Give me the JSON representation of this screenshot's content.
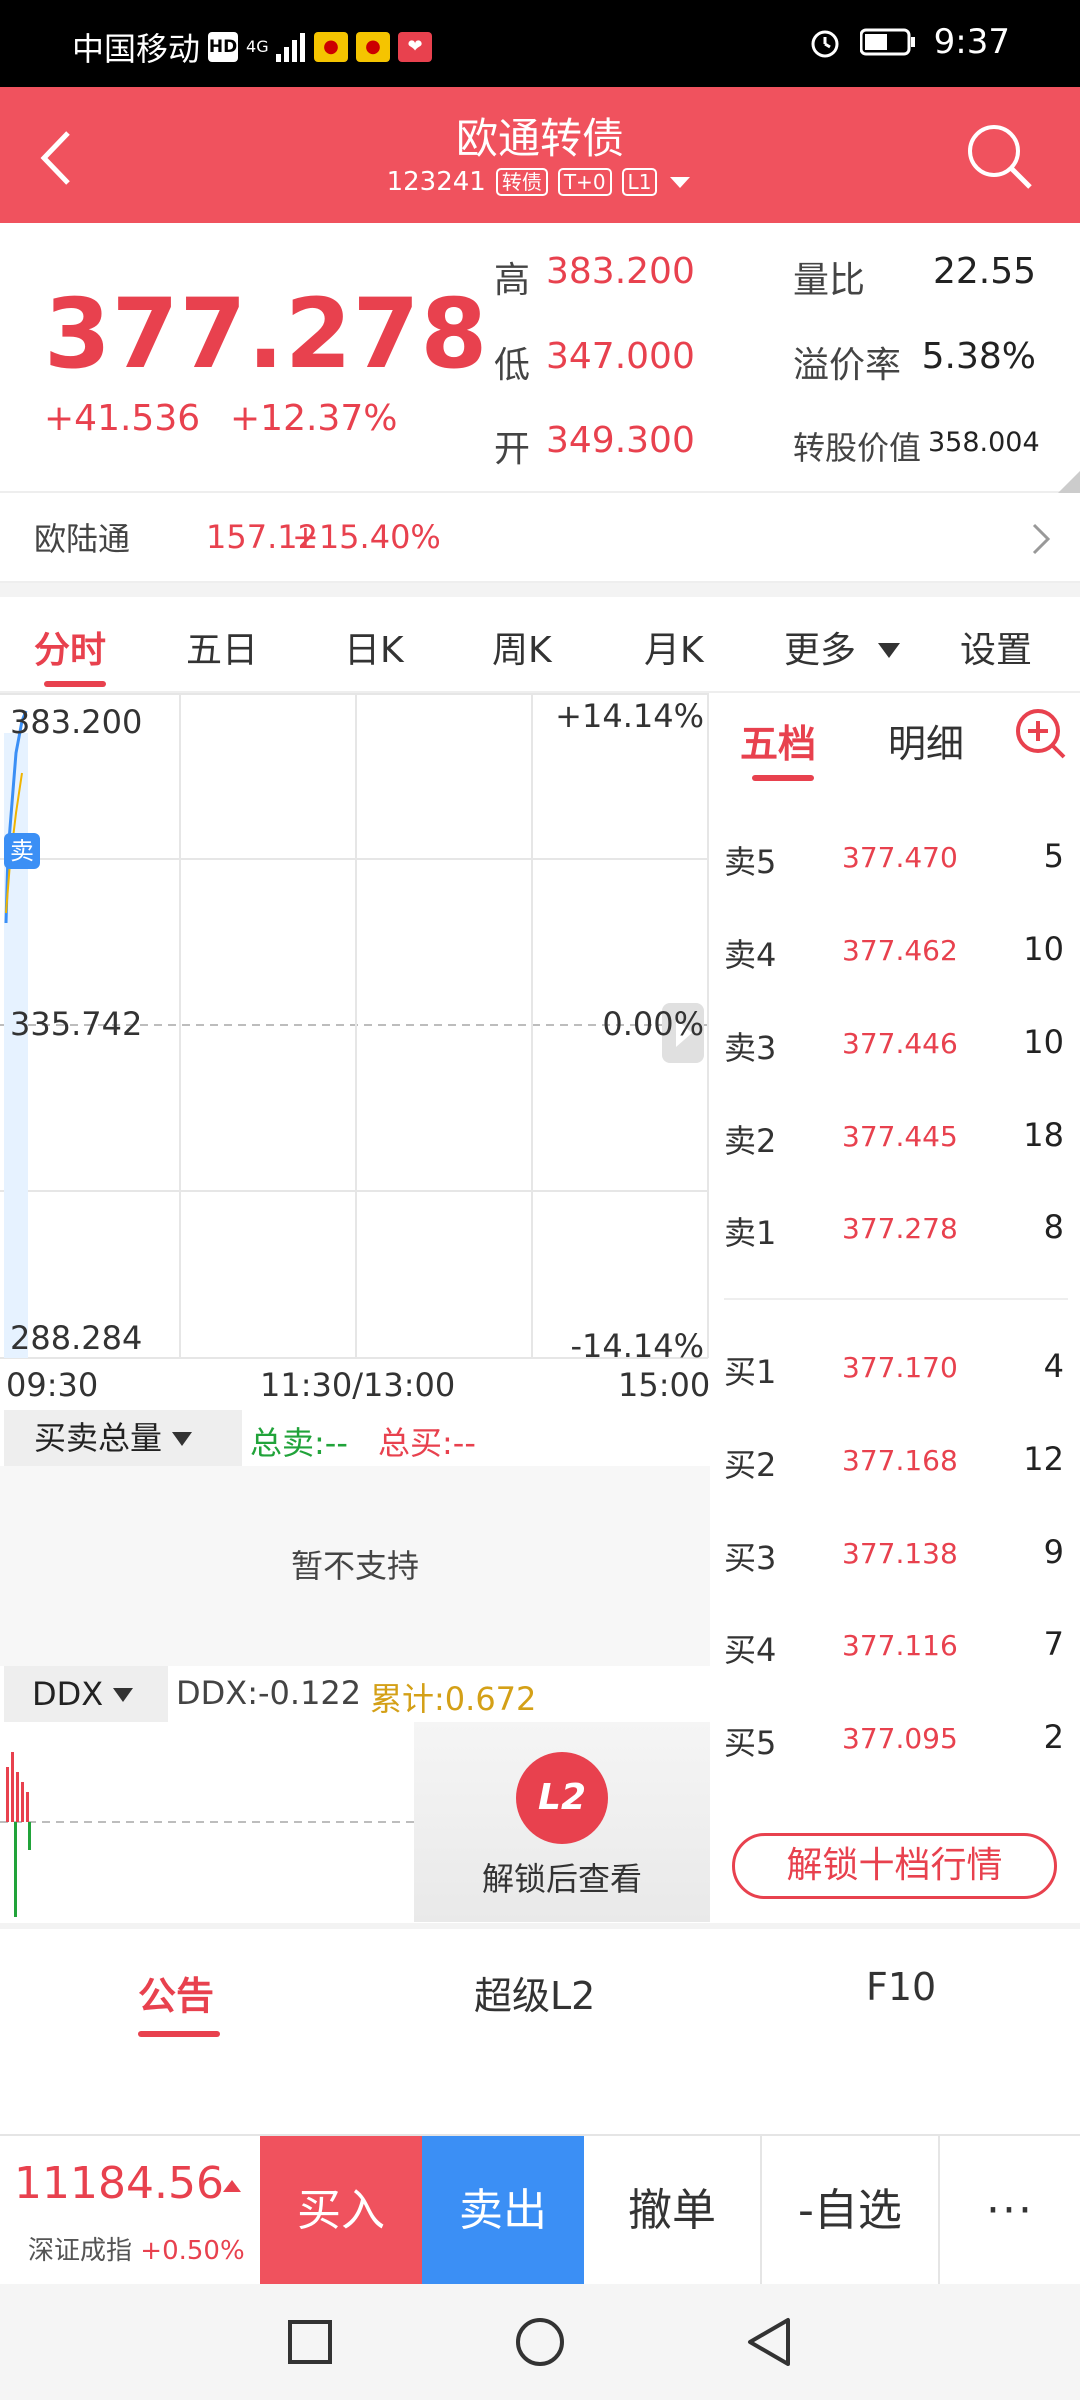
{
  "status": {
    "carrier": "中国移动",
    "hd": "HD",
    "net": "4G",
    "time": "9:37"
  },
  "header": {
    "title": "欧通转债",
    "code": "123241",
    "tags": [
      "转债",
      "T+0",
      "L1"
    ]
  },
  "quote": {
    "price": "377.278",
    "change": "+41.536",
    "change_pct": "+12.37%",
    "high_label": "高",
    "high": "383.200",
    "low_label": "低",
    "low": "347.000",
    "open_label": "开",
    "open": "349.300",
    "vol_ratio_label": "量比",
    "vol_ratio": "22.55",
    "premium_label": "溢价率",
    "premium": "5.38%",
    "conv_value_label": "转股价值",
    "conv_value": "358.004"
  },
  "underlying": {
    "name": "欧陆通",
    "price": "157.12",
    "change_pct": "+15.40%"
  },
  "tabs": [
    "分时",
    "五日",
    "日K",
    "周K",
    "月K",
    "更多",
    "设置"
  ],
  "chart": {
    "y_top": "383.200",
    "y_mid": "335.742",
    "y_bottom": "288.284",
    "pct_top": "+14.14%",
    "pct_mid": "0.00%",
    "pct_bottom": "-14.14%",
    "x_start": "09:30",
    "x_mid": "11:30/13:00",
    "x_end": "15:00",
    "sell_marker": "卖"
  },
  "book": {
    "tabs": [
      "五档",
      "明细"
    ],
    "sells": [
      {
        "label": "卖5",
        "price": "377.470",
        "vol": "5"
      },
      {
        "label": "卖4",
        "price": "377.462",
        "vol": "10"
      },
      {
        "label": "卖3",
        "price": "377.446",
        "vol": "10"
      },
      {
        "label": "卖2",
        "price": "377.445",
        "vol": "18"
      },
      {
        "label": "卖1",
        "price": "377.278",
        "vol": "8"
      }
    ],
    "buys": [
      {
        "label": "买1",
        "price": "377.170",
        "vol": "4"
      },
      {
        "label": "买2",
        "price": "377.168",
        "vol": "12"
      },
      {
        "label": "买3",
        "price": "377.138",
        "vol": "9"
      },
      {
        "label": "买4",
        "price": "377.116",
        "vol": "7"
      },
      {
        "label": "买5",
        "price": "377.095",
        "vol": "2"
      }
    ],
    "unlock": "解锁十档行情"
  },
  "volume": {
    "selector": "买卖总量",
    "total_sell": "总卖:--",
    "total_buy": "总买:--",
    "unsupported": "暂不支持"
  },
  "ddx": {
    "selector": "DDX",
    "ddx_value": "DDX:-0.122",
    "cumulative": "累计:0.672",
    "l2_badge": "L2",
    "unlock_view": "解锁后查看"
  },
  "bottom_tabs": [
    "公告",
    "超级L2",
    "F10"
  ],
  "toolbar": {
    "index_value": "11184.56",
    "index_name": "深证成指",
    "index_change": "+0.50%",
    "buy": "买入",
    "sell": "卖出",
    "cancel": "撤单",
    "watchlist": "-自选",
    "more": "···"
  },
  "colors": {
    "accent": "#f0525e",
    "up": "#e8414e",
    "sell_button": "#3b8ff5",
    "green": "#21a33a",
    "gold": "#d4a017"
  }
}
